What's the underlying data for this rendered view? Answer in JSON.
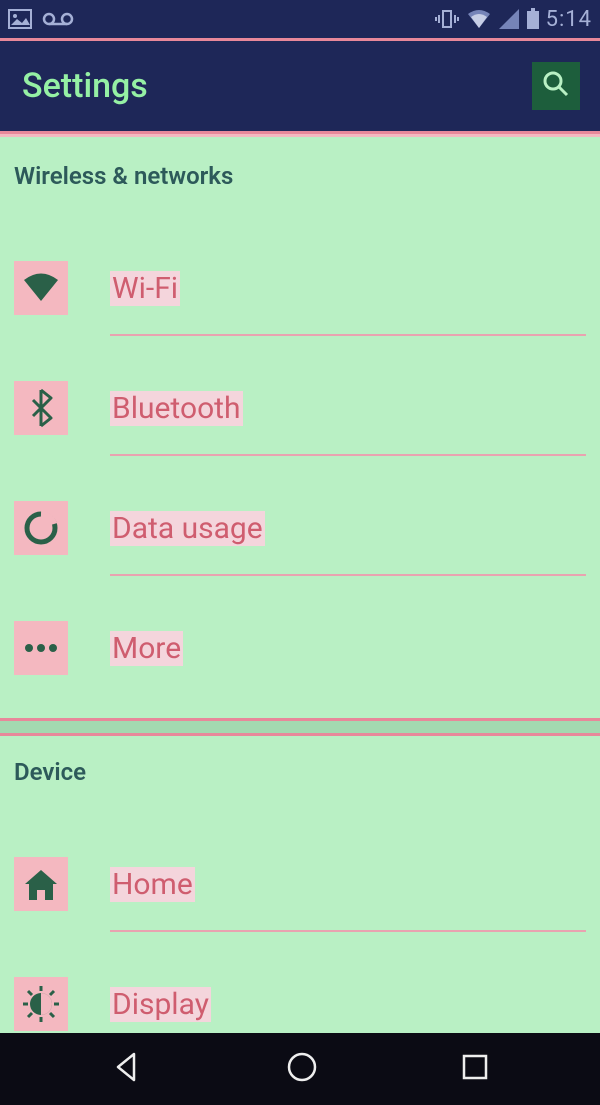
{
  "statusBar": {
    "time": "5:14"
  },
  "appBar": {
    "title": "Settings"
  },
  "sections": [
    {
      "title": "Wireless & networks",
      "items": [
        {
          "label": "Wi-Fi",
          "icon": "wifi"
        },
        {
          "label": "Bluetooth",
          "icon": "bluetooth"
        },
        {
          "label": "Data usage",
          "icon": "data"
        },
        {
          "label": "More",
          "icon": "more"
        }
      ]
    },
    {
      "title": "Device",
      "items": [
        {
          "label": "Home",
          "icon": "home"
        },
        {
          "label": "Display",
          "icon": "display"
        }
      ]
    }
  ]
}
